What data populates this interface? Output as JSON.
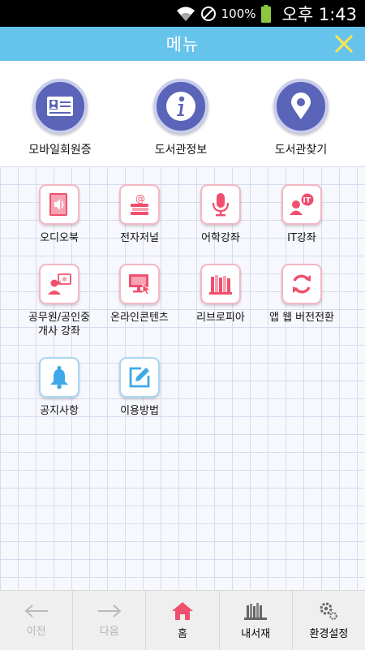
{
  "status_bar": {
    "battery": "100%",
    "time": "오후 1:43"
  },
  "header": {
    "title": "메뉴"
  },
  "top_items": [
    {
      "label": "모바일회원증",
      "icon": "member-card-icon"
    },
    {
      "label": "도서관정보",
      "icon": "info-icon"
    },
    {
      "label": "도서관찾기",
      "icon": "location-pin-icon"
    }
  ],
  "grid_items": [
    {
      "label": "오디오북",
      "icon": "audiobook-icon"
    },
    {
      "label": "전자저널",
      "icon": "ejournal-icon"
    },
    {
      "label": "어학강좌",
      "icon": "microphone-icon"
    },
    {
      "label": "IT강좌",
      "icon": "it-lecture-icon"
    },
    {
      "label": "공무원/공인중\n개사 강좌",
      "icon": "lecturer-icon"
    },
    {
      "label": "온라인콘텐츠",
      "icon": "online-content-icon"
    },
    {
      "label": "리브로피아",
      "icon": "books-icon"
    },
    {
      "label": "앱 웹 버전전환",
      "icon": "refresh-icon"
    },
    {
      "label": "공지사항",
      "icon": "bell-icon"
    },
    {
      "label": "이용방법",
      "icon": "edit-icon"
    }
  ],
  "bottom_nav": [
    {
      "label": "이전",
      "icon": "back-arrow-icon",
      "state": "disabled"
    },
    {
      "label": "다음",
      "icon": "forward-arrow-icon",
      "state": "disabled"
    },
    {
      "label": "홈",
      "icon": "home-icon",
      "state": "active"
    },
    {
      "label": "내서재",
      "icon": "library-icon",
      "state": "normal"
    },
    {
      "label": "환경설정",
      "icon": "gear-icon",
      "state": "normal"
    }
  ],
  "colors": {
    "header": "#66c3ec",
    "accent_pink": "#f04f6e",
    "accent_blue": "#3da9e8",
    "circle": "#5a64b9"
  }
}
